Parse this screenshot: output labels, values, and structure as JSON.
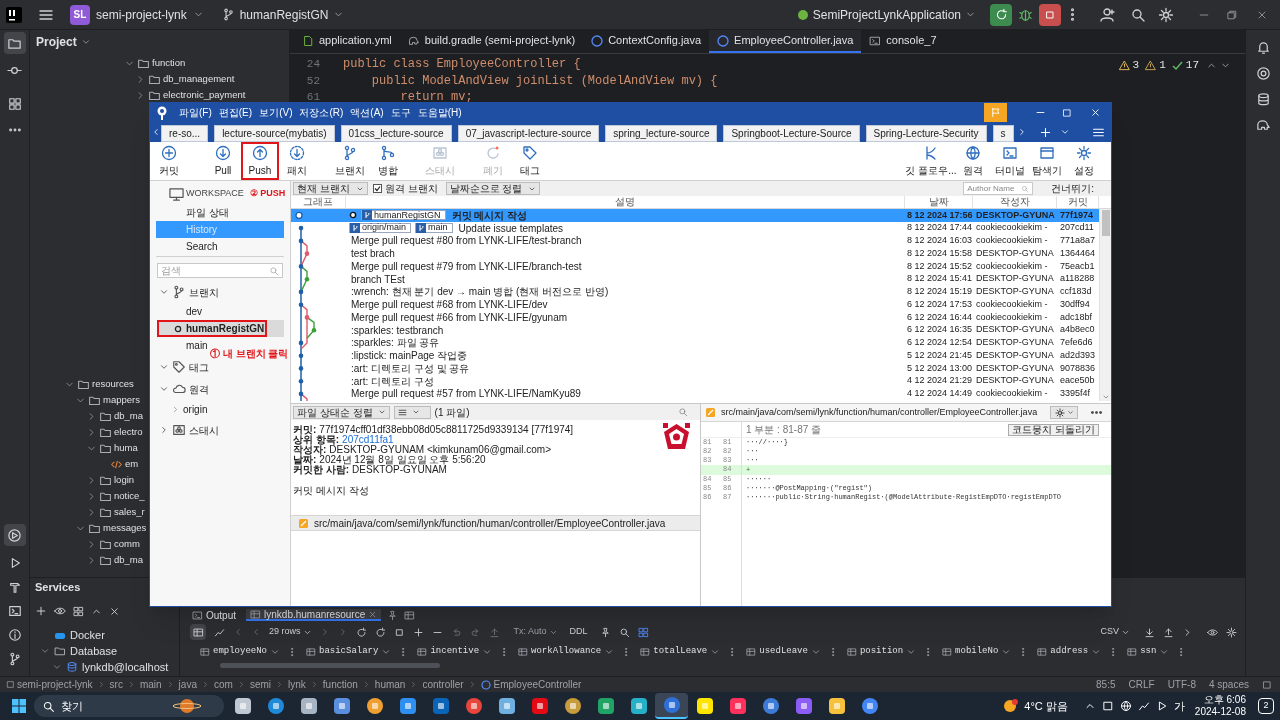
{
  "ide": {
    "top_bar": {
      "project_badge": "SL",
      "project": "semi-project-lynk",
      "branch": "humanRegistGN",
      "run_config": "SemiProjectLynkApplication"
    },
    "project_panel": {
      "title": "Project",
      "tree": [
        {
          "label": "function",
          "kind": "folder",
          "expanded": true,
          "children": [
            {
              "label": "db_management",
              "kind": "folder",
              "expanded": false
            },
            {
              "label": "electronic_payment",
              "kind": "folder",
              "expanded": false
            }
          ]
        },
        {
          "label": "resources",
          "kind": "folder",
          "expanded": true,
          "children": [
            {
              "label": "mappers",
              "kind": "folder",
              "expanded": true,
              "children": [
                {
                  "label": "db_ma",
                  "kind": "folder",
                  "expanded": false
                },
                {
                  "label": "electro",
                  "kind": "folder",
                  "expanded": false
                },
                {
                  "label": "huma",
                  "kind": "folder",
                  "expanded": true,
                  "children": [
                    {
                      "label": "em",
                      "kind": "file"
                    }
                  ]
                },
                {
                  "label": "login",
                  "kind": "folder",
                  "expanded": false
                },
                {
                  "label": "notice_",
                  "kind": "folder",
                  "expanded": false
                },
                {
                  "label": "sales_r",
                  "kind": "folder",
                  "expanded": false
                }
              ]
            },
            {
              "label": "messages",
              "kind": "folder",
              "expanded": true,
              "children": [
                {
                  "label": "comm",
                  "kind": "folder",
                  "expanded": false
                },
                {
                  "label": "db_ma",
                  "kind": "folder",
                  "expanded": false
                }
              ]
            }
          ]
        }
      ]
    },
    "editor": {
      "tabs": [
        {
          "label": "application.yml",
          "selected": false
        },
        {
          "label": "build.gradle (semi-project-lynk)",
          "selected": false
        },
        {
          "label": "ContextConfig.java",
          "selected": false
        },
        {
          "label": "EmployeeController.java",
          "selected": true
        },
        {
          "label": "console_7",
          "selected": false
        }
      ],
      "lines": [
        {
          "number": "24",
          "code": "public class EmployeeController {"
        },
        {
          "number": "52",
          "code": "    public ModelAndView joinList (ModelAndView mv) {"
        },
        {
          "number": "61",
          "code": "        return mv;"
        }
      ],
      "inspections": {
        "warnings": "3",
        "weak_warnings": "1",
        "typos": "17"
      }
    },
    "services": {
      "title": "Services",
      "tree": [
        {
          "label": "Docker"
        },
        {
          "label": "Database",
          "expanded": true,
          "children": [
            {
              "label": "lynkdb@localhost",
              "expanded": true
            }
          ]
        }
      ],
      "tabs": [
        {
          "label": "Output",
          "selected": false
        },
        {
          "label": "lynkdb.humanresource",
          "selected": true
        }
      ],
      "toolbar": {
        "rows": "29 rows",
        "tx": "Tx: Auto",
        "ddl": "DDL",
        "export": "CSV"
      },
      "columns": [
        "employeeNo",
        "basicSalary",
        "incentive",
        "workAllowance",
        "totalLeave",
        "usedLeave",
        "position",
        "mobileNo",
        "address",
        "ssn"
      ]
    },
    "status_bar": {
      "path": [
        "semi-project-lynk",
        "src",
        "main",
        "java",
        "com",
        "semi",
        "lynk",
        "function",
        "human",
        "controller",
        "EmployeeController"
      ],
      "position": "85:5",
      "line_separator": "CRLF",
      "encoding": "UTF-8",
      "indent": "4 spaces"
    },
    "taskbar": {
      "search": "찾기",
      "apps": [
        {
          "selected": false
        },
        {
          "selected": false
        },
        {
          "selected": false
        },
        {
          "selected": false
        },
        {
          "selected": false
        },
        {
          "selected": false
        },
        {
          "selected": false
        },
        {
          "selected": false
        },
        {
          "selected": false
        },
        {
          "selected": false
        },
        {
          "selected": false
        },
        {
          "selected": false
        },
        {
          "selected": false
        },
        {
          "selected": true
        },
        {
          "selected": false
        },
        {
          "selected": false
        },
        {
          "selected": false
        },
        {
          "selected": false
        },
        {
          "selected": false
        },
        {
          "selected": false
        }
      ],
      "weather": "4°C 맑음",
      "input_method": "가",
      "time": "오후 6:06",
      "date": "2024-12-08",
      "notifications": "2"
    }
  },
  "sourcetree": {
    "menu": [
      "파일(F)",
      "편집(E)",
      "보기(V)",
      "저장소(R)",
      "액션(A)",
      "도구",
      "도움말(H)"
    ],
    "repo_tabs": [
      "re-so...",
      "lecture-source(mybatis)",
      "01css_lecture-source",
      "07_javascript-lecture-source",
      "spring_lecture-source",
      "Springboot-Lecture-Source",
      "Spring-Lecture-Security",
      "s"
    ],
    "toolbar": [
      {
        "label": "커밋",
        "disabled": false,
        "highlighted": false
      },
      {
        "label": "Pull",
        "disabled": false,
        "highlighted": false
      },
      {
        "label": "Push",
        "disabled": false,
        "highlighted": true
      },
      {
        "label": "패치",
        "disabled": false,
        "highlighted": false
      },
      {
        "label": "브랜치",
        "disabled": false,
        "highlighted": false
      },
      {
        "label": "병합",
        "disabled": false,
        "highlighted": false
      },
      {
        "label": "스태시",
        "disabled": true,
        "highlighted": false
      },
      {
        "label": "폐기",
        "disabled": true,
        "highlighted": false
      },
      {
        "label": "태그",
        "disabled": false,
        "highlighted": false
      }
    ],
    "toolbar_right": [
      "깃 플로우...",
      "원격",
      "터미널",
      "탐색기",
      "설정"
    ],
    "annotations": {
      "push": "② PUSH",
      "branch": "① 내 브랜치 클릭"
    },
    "sidebar": {
      "workspace": "WORKSPACE",
      "views": [
        {
          "label": "파일 상태",
          "selected": false
        },
        {
          "label": "History",
          "selected": true
        },
        {
          "label": "Search",
          "selected": false
        }
      ],
      "search_placeholder": "검색",
      "groups": [
        {
          "label": "브랜치",
          "expanded": true,
          "items": [
            {
              "label": "dev",
              "current": false,
              "selected": false,
              "highlighted": false
            },
            {
              "label": "humanRegistGN",
              "current": true,
              "selected": true,
              "highlighted": true
            },
            {
              "label": "main",
              "current": false,
              "selected": false,
              "highlighted": false
            }
          ]
        },
        {
          "label": "태그",
          "expanded": true
        },
        {
          "label": "원격",
          "expanded": true,
          "items": [
            {
              "label": "origin",
              "expanded": false
            }
          ]
        },
        {
          "label": "스태시",
          "expanded": false
        }
      ]
    },
    "history": {
      "branch_filter": "현재 브랜치",
      "remote_branches": {
        "label": "원격 브랜치",
        "checked": true
      },
      "sort": "날짜순으로 정렬",
      "author_placeholder": "Author Name",
      "skip_label": "건너뛰기:",
      "columns": [
        "그래프",
        "설명",
        "날짜",
        "작성자",
        "커밋"
      ],
      "commits": [
        {
          "refs": [
            "humanRegistGN"
          ],
          "head": true,
          "message": "커밋 메시지 작성",
          "date": "8 12 2024 17:56",
          "author": "DESKTOP-GYUNA",
          "hash": "77f1974",
          "selected": true
        },
        {
          "refs": [
            "origin/main",
            "main"
          ],
          "head": false,
          "message": "Update issue templates",
          "date": "8 12 2024 17:44",
          "author": "cookiecookiekim -",
          "hash": "207cd11",
          "selected": false
        },
        {
          "head": false,
          "message": "Merge pull request #80 from LYNK-LIFE/test-branch",
          "date": "8 12 2024 16:03",
          "author": "cookiecookiekim -",
          "hash": "771a8a7",
          "selected": false
        },
        {
          "head": false,
          "message": "test brach",
          "date": "8 12 2024 15:58",
          "author": "DESKTOP-GYUNA",
          "hash": "1364464",
          "selected": false
        },
        {
          "head": false,
          "message": "Merge pull request #79 from LYNK-LIFE/branch-test",
          "date": "8 12 2024 15:52",
          "author": "cookiecookiekim -",
          "hash": "75eacb1",
          "selected": false
        },
        {
          "head": false,
          "message": "branch TEst",
          "date": "8 12 2024 15:41",
          "author": "DESKTOP-GYUNA",
          "hash": "a118288",
          "selected": false
        },
        {
          "head": false,
          "message": ":wrench: 현재 분기 dev → main 병합 (현재 버전으로 반영)",
          "date": "8 12 2024 15:19",
          "author": "DESKTOP-GYUNA",
          "hash": "ccf183d",
          "selected": false
        },
        {
          "head": false,
          "message": "Merge pull request #68 from LYNK-LIFE/dev",
          "date": "6 12 2024 17:53",
          "author": "cookiecookiekim -",
          "hash": "30dff94",
          "selected": false
        },
        {
          "head": false,
          "message": "Merge pull request #66 from LYNK-LIFE/gyunam",
          "date": "6 12 2024 16:44",
          "author": "cookiecookiekim -",
          "hash": "adc18bf",
          "selected": false
        },
        {
          "head": false,
          "message": ":sparkles: testbranch",
          "date": "6 12 2024 16:35",
          "author": "DESKTOP-GYUNA",
          "hash": "a4b8ec0",
          "selected": false
        },
        {
          "head": false,
          "message": ":sparkles: 파일 공유",
          "date": "6 12 2024 12:54",
          "author": "DESKTOP-GYUNA",
          "hash": "7efe6d6",
          "selected": false
        },
        {
          "head": false,
          "message": ":lipstick: mainPage 작업중",
          "date": "5 12 2024 21:45",
          "author": "DESKTOP-GYUNA",
          "hash": "ad2d393",
          "selected": false
        },
        {
          "head": false,
          "message": ":art: 디렉토리 구성 및 공유",
          "date": "5 12 2024 13:00",
          "author": "DESKTOP-GYUNA",
          "hash": "9078836",
          "selected": false
        },
        {
          "head": false,
          "message": ":art: 디렉토리 구성",
          "date": "4 12 2024 21:29",
          "author": "DESKTOP-GYUNA",
          "hash": "eace50b",
          "selected": false
        },
        {
          "head": false,
          "message": "Merge pull request #57 from LYNK-LIFE/NamKyu89",
          "date": "4 12 2024 14:49",
          "author": "cookiecookiekim -",
          "hash": "3395f4f",
          "selected": false
        }
      ]
    },
    "details": {
      "sort": "파일 상태순 정렬",
      "file_count": "(1 파일)",
      "fields": [
        {
          "label": "커밋:",
          "value": "77f1974cff01df38ebb08d05c8811725d9339134 [77f1974]",
          "kind": "text"
        },
        {
          "label": "상위 항목:",
          "value": "207cd11fa1",
          "kind": "link"
        },
        {
          "label": "작성자:",
          "value": "DESKTOP-GYUNAM <kimkunam06@gmail.com>",
          "kind": "text"
        },
        {
          "label": "날짜:",
          "value": "2024년 12월 8일 일요일 오후 5:56:20",
          "kind": "text"
        },
        {
          "label": "커밋한 사람:",
          "value": "DESKTOP-GYUNAM",
          "kind": "text"
        }
      ],
      "message": "커밋 메시지 작성",
      "files": [
        "src/main/java/com/semi/lynk/function/human/controller/EmployeeController.java"
      ]
    },
    "diff": {
      "path": "src/main/java/com/semi/lynk/function/human/controller/EmployeeController.java",
      "hunk": "1 부분 : 81-87 줄",
      "revert": "코드뭉치 되돌리기",
      "lines": [
        {
          "old": "81",
          "new": "81",
          "text": "···//····}",
          "kind": "context"
        },
        {
          "old": "82",
          "new": "82",
          "text": "···",
          "kind": "context"
        },
        {
          "old": "83",
          "new": "83",
          "text": "···",
          "kind": "context"
        },
        {
          "new": "84",
          "text": "+",
          "kind": "added"
        },
        {
          "old": "84",
          "new": "85",
          "text": "······",
          "kind": "context"
        },
        {
          "old": "85",
          "new": "86",
          "text": "·······@PostMapping·(\"regist\")",
          "kind": "context"
        },
        {
          "old": "86",
          "new": "87",
          "text": "·······public·String·humanRegist·(@ModelAttribute·RegistEmpDTO·registEmpDTO",
          "kind": "context"
        }
      ]
    }
  }
}
